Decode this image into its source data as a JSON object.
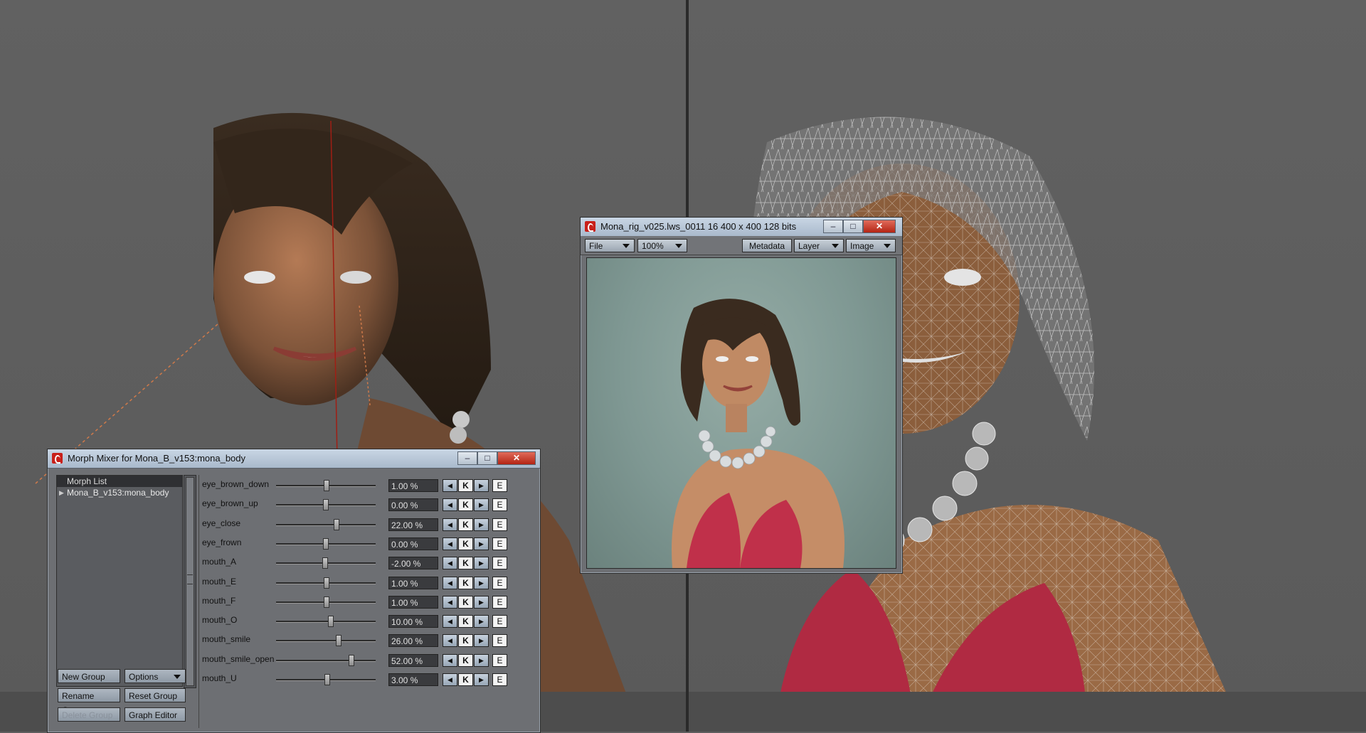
{
  "morph_window": {
    "title": "Morph Mixer for Mona_B_v153:mona_body",
    "list_header": "Morph List",
    "list_items": [
      "Mona_B_v153:mona_body"
    ],
    "buttons": {
      "new_group": "New Group",
      "options": "Options",
      "rename_group": "Rename Group",
      "reset_group": "Reset Group",
      "delete_group": "Delete Group",
      "graph_editor": "Graph Editor"
    },
    "key_label": "K",
    "envelope_label": "E",
    "morphs": [
      {
        "name": "eye_brown_down",
        "value": "1.00 %",
        "level": 0.505
      },
      {
        "name": "eye_brown_up",
        "value": "0.00 %",
        "level": 0.5
      },
      {
        "name": "eye_close",
        "value": "22.00 %",
        "level": 0.61
      },
      {
        "name": "eye_frown",
        "value": "0.00 %",
        "level": 0.5
      },
      {
        "name": "mouth_A",
        "value": "-2.00 %",
        "level": 0.49
      },
      {
        "name": "mouth_E",
        "value": "1.00 %",
        "level": 0.505
      },
      {
        "name": "mouth_F",
        "value": "1.00 %",
        "level": 0.505
      },
      {
        "name": "mouth_O",
        "value": "10.00 %",
        "level": 0.55
      },
      {
        "name": "mouth_smile",
        "value": "26.00 %",
        "level": 0.63
      },
      {
        "name": "mouth_smile_open",
        "value": "52.00 %",
        "level": 0.76
      },
      {
        "name": "mouth_U",
        "value": "3.00 %",
        "level": 0.515
      }
    ]
  },
  "viewer_window": {
    "title": "Mona_rig_v025.lws_0011 16  400 x 400 128 bits",
    "file_menu": "File",
    "zoom": "100%",
    "metadata": "Metadata",
    "layer": "Layer",
    "image": "Image"
  },
  "colors": {
    "viewport_bg": "#5e5e5e",
    "titlebar": "#b9c8d9",
    "close_button": "#c6321f"
  }
}
